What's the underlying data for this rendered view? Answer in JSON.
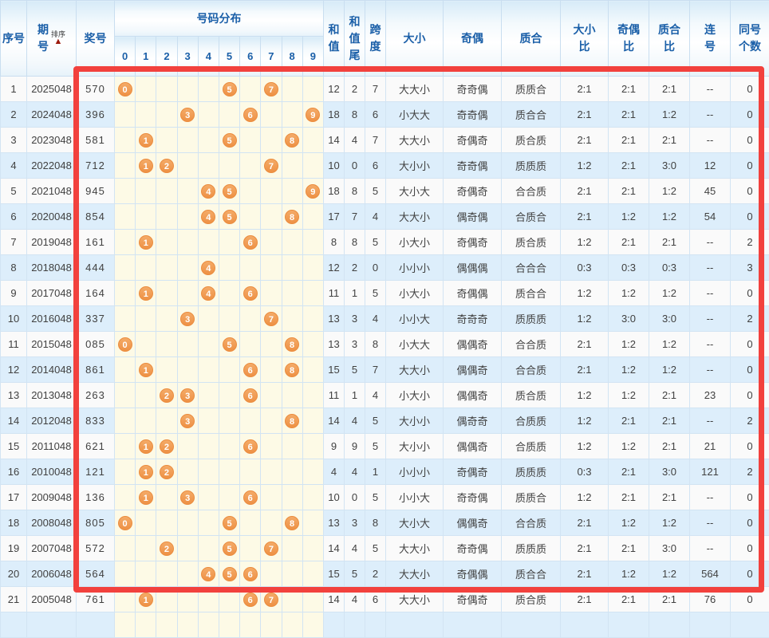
{
  "header": {
    "seq": "序号",
    "period": "期\n号",
    "sort": "排序",
    "sort_arrow": "▲",
    "number": "奖号",
    "distribution": "号码分布",
    "digits": [
      "0",
      "1",
      "2",
      "3",
      "4",
      "5",
      "6",
      "7",
      "8",
      "9"
    ],
    "sum": "和\n值",
    "sum_tail": "和\n值\n尾",
    "span": "跨\n度",
    "size": "大小",
    "parity": "奇偶",
    "prime": "质合",
    "size_ratio": "大小\n比",
    "parity_ratio": "奇偶\n比",
    "prime_ratio": "质合\n比",
    "consecutive": "连\n号",
    "same_count": "同号\n个数"
  },
  "colors": {
    "highlight_red": "#f2413d",
    "ball_orange": "#ee9145",
    "header_blue": "#1a5fa8",
    "even_row_blue": "#ddeefb",
    "ball_column_cream": "#fdfae6"
  },
  "rows": [
    {
      "seq": "1",
      "period": "2025048",
      "number": "570",
      "balls": [
        0,
        5,
        7
      ],
      "sum": "12",
      "tail": "2",
      "span": "7",
      "size": "大大小",
      "parity": "奇奇偶",
      "prime": "质质合",
      "size_ratio": "2:1",
      "parity_ratio": "2:1",
      "prime_ratio": "2:1",
      "consec": "--",
      "same": "0"
    },
    {
      "seq": "2",
      "period": "2024048",
      "number": "396",
      "balls": [
        3,
        6,
        9
      ],
      "sum": "18",
      "tail": "8",
      "span": "6",
      "size": "小大大",
      "parity": "奇奇偶",
      "prime": "质合合",
      "size_ratio": "2:1",
      "parity_ratio": "2:1",
      "prime_ratio": "1:2",
      "consec": "--",
      "same": "0"
    },
    {
      "seq": "3",
      "period": "2023048",
      "number": "581",
      "balls": [
        1,
        5,
        8
      ],
      "sum": "14",
      "tail": "4",
      "span": "7",
      "size": "大大小",
      "parity": "奇偶奇",
      "prime": "质合质",
      "size_ratio": "2:1",
      "parity_ratio": "2:1",
      "prime_ratio": "2:1",
      "consec": "--",
      "same": "0"
    },
    {
      "seq": "4",
      "period": "2022048",
      "number": "712",
      "balls": [
        1,
        2,
        7
      ],
      "sum": "10",
      "tail": "0",
      "span": "6",
      "size": "大小小",
      "parity": "奇奇偶",
      "prime": "质质质",
      "size_ratio": "1:2",
      "parity_ratio": "2:1",
      "prime_ratio": "3:0",
      "consec": "12",
      "same": "0"
    },
    {
      "seq": "5",
      "period": "2021048",
      "number": "945",
      "balls": [
        4,
        5,
        9
      ],
      "sum": "18",
      "tail": "8",
      "span": "5",
      "size": "大小大",
      "parity": "奇偶奇",
      "prime": "合合质",
      "size_ratio": "2:1",
      "parity_ratio": "2:1",
      "prime_ratio": "1:2",
      "consec": "45",
      "same": "0"
    },
    {
      "seq": "6",
      "period": "2020048",
      "number": "854",
      "balls": [
        4,
        5,
        8
      ],
      "sum": "17",
      "tail": "7",
      "span": "4",
      "size": "大大小",
      "parity": "偶奇偶",
      "prime": "合质合",
      "size_ratio": "2:1",
      "parity_ratio": "1:2",
      "prime_ratio": "1:2",
      "consec": "54",
      "same": "0"
    },
    {
      "seq": "7",
      "period": "2019048",
      "number": "161",
      "balls": [
        1,
        6
      ],
      "sum": "8",
      "tail": "8",
      "span": "5",
      "size": "小大小",
      "parity": "奇偶奇",
      "prime": "质合质",
      "size_ratio": "1:2",
      "parity_ratio": "2:1",
      "prime_ratio": "2:1",
      "consec": "--",
      "same": "2"
    },
    {
      "seq": "8",
      "period": "2018048",
      "number": "444",
      "balls": [
        4
      ],
      "sum": "12",
      "tail": "2",
      "span": "0",
      "size": "小小小",
      "parity": "偶偶偶",
      "prime": "合合合",
      "size_ratio": "0:3",
      "parity_ratio": "0:3",
      "prime_ratio": "0:3",
      "consec": "--",
      "same": "3"
    },
    {
      "seq": "9",
      "period": "2017048",
      "number": "164",
      "balls": [
        1,
        4,
        6
      ],
      "sum": "11",
      "tail": "1",
      "span": "5",
      "size": "小大小",
      "parity": "奇偶偶",
      "prime": "质合合",
      "size_ratio": "1:2",
      "parity_ratio": "1:2",
      "prime_ratio": "1:2",
      "consec": "--",
      "same": "0"
    },
    {
      "seq": "10",
      "period": "2016048",
      "number": "337",
      "balls": [
        3,
        7
      ],
      "sum": "13",
      "tail": "3",
      "span": "4",
      "size": "小小大",
      "parity": "奇奇奇",
      "prime": "质质质",
      "size_ratio": "1:2",
      "parity_ratio": "3:0",
      "prime_ratio": "3:0",
      "consec": "--",
      "same": "2"
    },
    {
      "seq": "11",
      "period": "2015048",
      "number": "085",
      "balls": [
        0,
        5,
        8
      ],
      "sum": "13",
      "tail": "3",
      "span": "8",
      "size": "小大大",
      "parity": "偶偶奇",
      "prime": "合合质",
      "size_ratio": "2:1",
      "parity_ratio": "1:2",
      "prime_ratio": "1:2",
      "consec": "--",
      "same": "0"
    },
    {
      "seq": "12",
      "period": "2014048",
      "number": "861",
      "balls": [
        1,
        6,
        8
      ],
      "sum": "15",
      "tail": "5",
      "span": "7",
      "size": "大大小",
      "parity": "偶偶奇",
      "prime": "合合质",
      "size_ratio": "2:1",
      "parity_ratio": "1:2",
      "prime_ratio": "1:2",
      "consec": "--",
      "same": "0"
    },
    {
      "seq": "13",
      "period": "2013048",
      "number": "263",
      "balls": [
        2,
        3,
        6
      ],
      "sum": "11",
      "tail": "1",
      "span": "4",
      "size": "小大小",
      "parity": "偶偶奇",
      "prime": "质合质",
      "size_ratio": "1:2",
      "parity_ratio": "1:2",
      "prime_ratio": "2:1",
      "consec": "23",
      "same": "0"
    },
    {
      "seq": "14",
      "period": "2012048",
      "number": "833",
      "balls": [
        3,
        8
      ],
      "sum": "14",
      "tail": "4",
      "span": "5",
      "size": "大小小",
      "parity": "偶奇奇",
      "prime": "合质质",
      "size_ratio": "1:2",
      "parity_ratio": "2:1",
      "prime_ratio": "2:1",
      "consec": "--",
      "same": "2"
    },
    {
      "seq": "15",
      "period": "2011048",
      "number": "621",
      "balls": [
        1,
        2,
        6
      ],
      "sum": "9",
      "tail": "9",
      "span": "5",
      "size": "大小小",
      "parity": "偶偶奇",
      "prime": "合质质",
      "size_ratio": "1:2",
      "parity_ratio": "1:2",
      "prime_ratio": "2:1",
      "consec": "21",
      "same": "0"
    },
    {
      "seq": "16",
      "period": "2010048",
      "number": "121",
      "balls": [
        1,
        2
      ],
      "sum": "4",
      "tail": "4",
      "span": "1",
      "size": "小小小",
      "parity": "奇偶奇",
      "prime": "质质质",
      "size_ratio": "0:3",
      "parity_ratio": "2:1",
      "prime_ratio": "3:0",
      "consec": "121",
      "same": "2"
    },
    {
      "seq": "17",
      "period": "2009048",
      "number": "136",
      "balls": [
        1,
        3,
        6
      ],
      "sum": "10",
      "tail": "0",
      "span": "5",
      "size": "小小大",
      "parity": "奇奇偶",
      "prime": "质质合",
      "size_ratio": "1:2",
      "parity_ratio": "2:1",
      "prime_ratio": "2:1",
      "consec": "--",
      "same": "0"
    },
    {
      "seq": "18",
      "period": "2008048",
      "number": "805",
      "balls": [
        0,
        5,
        8
      ],
      "sum": "13",
      "tail": "3",
      "span": "8",
      "size": "大小大",
      "parity": "偶偶奇",
      "prime": "合合质",
      "size_ratio": "2:1",
      "parity_ratio": "1:2",
      "prime_ratio": "1:2",
      "consec": "--",
      "same": "0"
    },
    {
      "seq": "19",
      "period": "2007048",
      "number": "572",
      "balls": [
        2,
        5,
        7
      ],
      "sum": "14",
      "tail": "4",
      "span": "5",
      "size": "大大小",
      "parity": "奇奇偶",
      "prime": "质质质",
      "size_ratio": "2:1",
      "parity_ratio": "2:1",
      "prime_ratio": "3:0",
      "consec": "--",
      "same": "0"
    },
    {
      "seq": "20",
      "period": "2006048",
      "number": "564",
      "balls": [
        4,
        5,
        6
      ],
      "sum": "15",
      "tail": "5",
      "span": "2",
      "size": "大大小",
      "parity": "奇偶偶",
      "prime": "质合合",
      "size_ratio": "2:1",
      "parity_ratio": "1:2",
      "prime_ratio": "1:2",
      "consec": "564",
      "same": "0"
    },
    {
      "seq": "21",
      "period": "2005048",
      "number": "761",
      "balls": [
        1,
        6,
        7
      ],
      "sum": "14",
      "tail": "4",
      "span": "6",
      "size": "大大小",
      "parity": "奇偶奇",
      "prime": "质合质",
      "size_ratio": "2:1",
      "parity_ratio": "2:1",
      "prime_ratio": "2:1",
      "consec": "76",
      "same": "0"
    }
  ]
}
